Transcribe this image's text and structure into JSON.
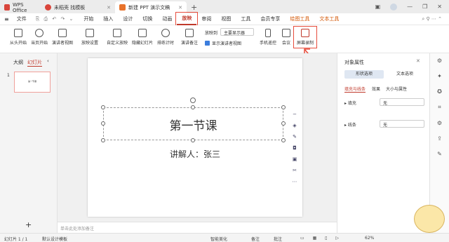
{
  "tabs": [
    {
      "label": "WPS Office",
      "color": "#d9453b"
    },
    {
      "label": "未稻壳 找模板",
      "color": "#d9453b"
    },
    {
      "label": "新建 PPT 演示文稿",
      "color": "#e8722a"
    }
  ],
  "new_tab": "+",
  "menu": {
    "file": "文件",
    "items": [
      "开始",
      "插入",
      "设计",
      "切换",
      "动画",
      "放映",
      "审阅",
      "视图",
      "工具",
      "会员专享",
      "绘图工具",
      "文本工具"
    ]
  },
  "ribbon": {
    "buttons": [
      {
        "label": "从头开始"
      },
      {
        "label": "当页开始"
      },
      {
        "label": "演讲者视图"
      },
      {
        "label": "放映设置"
      },
      {
        "label": "自定义放映"
      },
      {
        "label": "隐藏幻灯片"
      },
      {
        "label": "排练计时"
      },
      {
        "label": "演讲备注"
      },
      {
        "label": "手机遥控"
      },
      {
        "label": "会议"
      },
      {
        "label": "屏幕录制"
      }
    ],
    "display_label": "放映到",
    "display_value": "主要显示器",
    "show_presenter": "显示演讲者视图"
  },
  "left": {
    "tab_outline": "大纲",
    "tab_slides": "幻灯片",
    "slide_number": "1"
  },
  "slide": {
    "title": "第一节课",
    "subtitle": "讲解人：张三"
  },
  "notes_placeholder": "单击此处添加备注",
  "right": {
    "title": "对象属性",
    "tab_shape": "形状选项",
    "tab_text": "文本选项",
    "subtabs": [
      "填充与线条",
      "效果",
      "大小与属性"
    ],
    "fill_label": "填充",
    "fill_value": "无",
    "line_label": "线条",
    "line_value": "无"
  },
  "status": {
    "slide": "幻灯片 1 / 1",
    "template": "默认设计模板",
    "smart": "智能美化",
    "notes": "备注",
    "comment": "批注",
    "zoom": "62%"
  },
  "colors": {
    "accent": "#c0392b",
    "orange": "#d35400",
    "highlight": "#e74c3c"
  }
}
